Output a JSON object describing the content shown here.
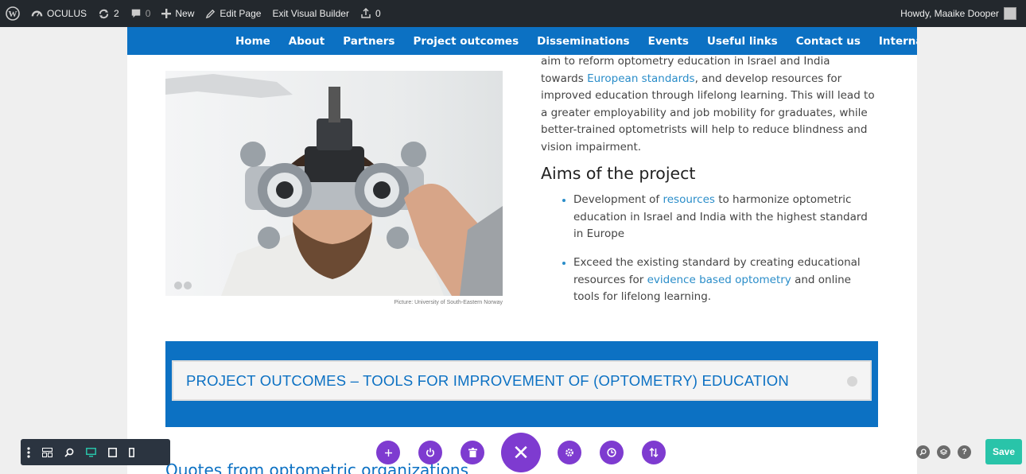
{
  "adminbar": {
    "site_name": "OCULUS",
    "updates_count": "2",
    "comments_count": "0",
    "new_label": "New",
    "edit_page_label": "Edit Page",
    "exit_vb_label": "Exit Visual Builder",
    "stats_count": "0",
    "howdy": "Howdy, Maaike Dooper"
  },
  "nav": {
    "items": [
      "Home",
      "About",
      "Partners",
      "Project outcomes",
      "Disseminations",
      "Events",
      "Useful links",
      "Contact us",
      "Internal"
    ]
  },
  "content": {
    "caption": "Picture: University of South-Eastern Norway",
    "para": {
      "t1": "aim to reform optometry education in Israel and India towards ",
      "link1": "European standards",
      "t2": ", and develop resources for improved education through lifelong learning. This will lead to a greater employability and job mobility for graduates, while better-trained optometrists will help to reduce blindness and vision impairment."
    },
    "aims_title": "Aims of the project",
    "bullet1": {
      "t1": "Development of ",
      "link": "resources",
      "t2": " to harmonize optometric education in Israel and India with the highest standard in Europe"
    },
    "bullet2": {
      "t1": "Exceed the existing standard by creating educational resources for ",
      "link": "evidence based optometry",
      "t2": " and online tools for lifelong learning."
    },
    "outcomes_title": "PROJECT OUTCOMES – TOOLS FOR IMPROVEMENT OF (OPTOMETRY) EDUCATION",
    "quotes_title": "Quotes from optometric organizations"
  },
  "builder": {
    "close_glyph": "✕",
    "save_label": "Save",
    "help_glyph": "?"
  },
  "colors": {
    "nav_blue": "#0c71c3",
    "builder_purple": "#7e3bd0",
    "save_green": "#29c4a9",
    "link_blue": "#2a8dc9"
  }
}
